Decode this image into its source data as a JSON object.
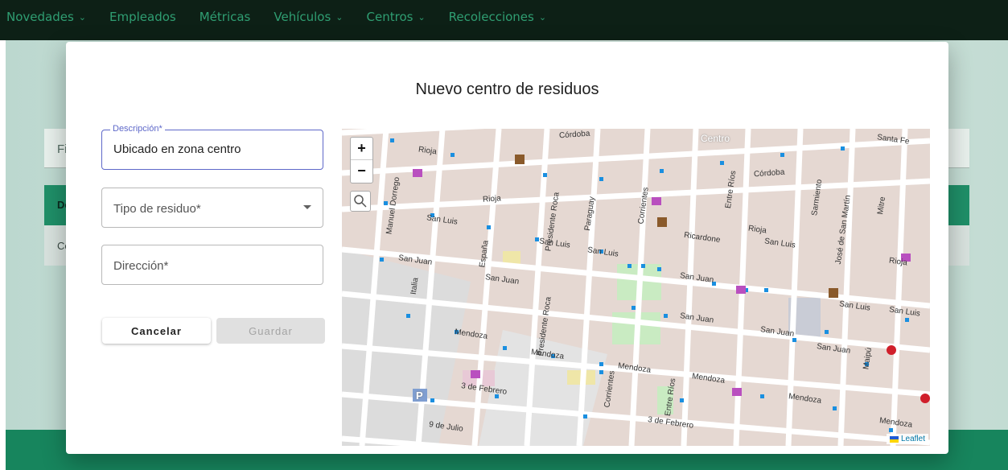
{
  "nav": {
    "items": [
      {
        "label": "Novedades",
        "dropdown": true
      },
      {
        "label": "Empleados",
        "dropdown": false
      },
      {
        "label": "Métricas",
        "dropdown": false
      },
      {
        "label": "Vehículos",
        "dropdown": true
      },
      {
        "label": "Centros",
        "dropdown": true
      },
      {
        "label": "Recolecciones",
        "dropdown": true
      }
    ],
    "chevron": "⌄"
  },
  "background": {
    "filter_text": "Fi",
    "header_text": "De",
    "row_text": "Ce"
  },
  "modal": {
    "title": "Nuevo centro de residuos",
    "description": {
      "label": "Descripción*",
      "value": "Ubicado en zona centro"
    },
    "waste_type": {
      "placeholder": "Tipo de residuo*"
    },
    "address": {
      "placeholder": "Dirección*"
    },
    "cancel_label": "Cancelar",
    "save_label": "Guardar"
  },
  "map": {
    "zoom_in": "+",
    "zoom_out": "−",
    "attribution": "Leaflet",
    "labels": {
      "centro": "Centro",
      "cordoba": "Córdoba",
      "rioja": "Rioja",
      "san_luis": "San Luis",
      "san_juan": "San Juan",
      "mendoza": "Mendoza",
      "tres_de_febrero": "3 de Febrero",
      "nueve_de_julio": "9 de Julio",
      "santa_fe": "Santa Fe",
      "corrientes": "Corrientes",
      "entre_rios": "Entre Ríos",
      "paraguay": "Paraguay",
      "presidente_roca": "Presidente Roca",
      "espana": "España",
      "italia": "Italia",
      "manuel_dorrego": "Manuel Dorrego",
      "sarmiento": "Sarmiento",
      "maipu": "Maipú",
      "jose_de_san_martin": "José de San Martín",
      "mitre": "Mitre",
      "ricardone": "Ricardone",
      "parking": "P"
    },
    "colors": {
      "roads": "#ffffff",
      "blocks": "#e8dcd6",
      "stops": "#1a8fe0",
      "park": "#c9ebc2"
    }
  },
  "colors": {
    "nav_bg": "#0d2016",
    "nav_text": "#2f9e72",
    "accent": "#17855d",
    "focus": "#5e68c9"
  }
}
